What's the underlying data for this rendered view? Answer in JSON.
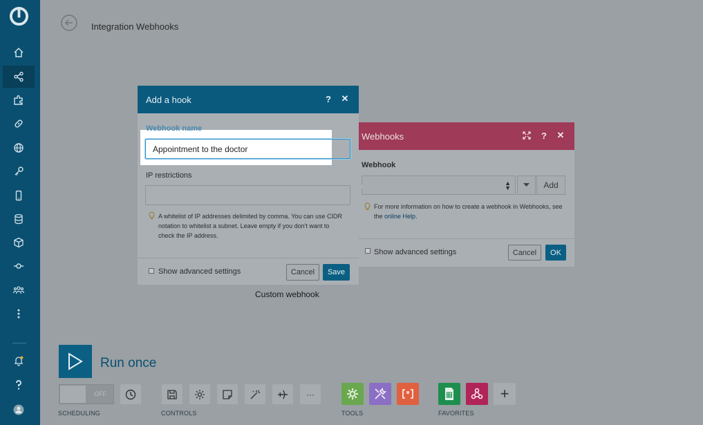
{
  "header": {
    "breadcrumb": "Integration Webhooks"
  },
  "module": {
    "label": "Custom webhook"
  },
  "hook_dialog": {
    "title": "Add a hook",
    "webhook_name_label": "Webhook name",
    "webhook_name_value": "Appointment to the doctor",
    "ip_label": "IP restrictions",
    "ip_value": "",
    "ip_hint": "A whitelist of IP addresses delimited by comma. You can use CIDR notation to whitelist a subnet. Leave empty if you don't want to check the IP address.",
    "advanced_label": "Show advanced settings",
    "cancel_label": "Cancel",
    "save_label": "Save",
    "help_icon": "question-icon",
    "close_icon": "close-icon"
  },
  "webhooks_panel": {
    "title": "Webhooks",
    "field_label": "Webhook",
    "selected_value": "",
    "add_label": "Add",
    "hint_text": "For more information on how to create a webhook in Webhooks, see the",
    "hint_link": "online Help",
    "hint_end": ".",
    "advanced_label": "Show advanced settings",
    "cancel_label": "Cancel",
    "ok_label": "OK",
    "header_color": "#9f3a58"
  },
  "toolbar": {
    "run_label": "Run once",
    "toggle_state": "OFF",
    "sections": {
      "scheduling": "SCHEDULING",
      "controls": "CONTROLS",
      "tools": "TOOLS",
      "favorites": "FAVORITES"
    },
    "more_label": "···",
    "add_label": "+"
  },
  "sidebar": {
    "items": [
      {
        "icon": "home-icon"
      },
      {
        "icon": "share-icon",
        "active": true
      },
      {
        "icon": "puzzle-icon"
      },
      {
        "icon": "link-icon"
      },
      {
        "icon": "globe-icon"
      },
      {
        "icon": "key-icon"
      },
      {
        "icon": "mobile-icon"
      },
      {
        "icon": "database-icon"
      },
      {
        "icon": "cube-icon"
      },
      {
        "icon": "flow-icon"
      },
      {
        "icon": "team-icon"
      },
      {
        "icon": "more-vertical-icon"
      }
    ],
    "bottom": [
      {
        "icon": "bell-icon"
      },
      {
        "icon": "help-icon"
      },
      {
        "icon": "avatar-icon"
      }
    ]
  },
  "colors": {
    "accent": "#0b5f83",
    "sidebar": "#0a4f6f",
    "tools_green": "#6aa84f",
    "tools_purple": "#8b6fc4",
    "tools_red": "#e06040",
    "fav_sheets": "#1e8e4e",
    "fav_webhooks": "#b02457"
  }
}
